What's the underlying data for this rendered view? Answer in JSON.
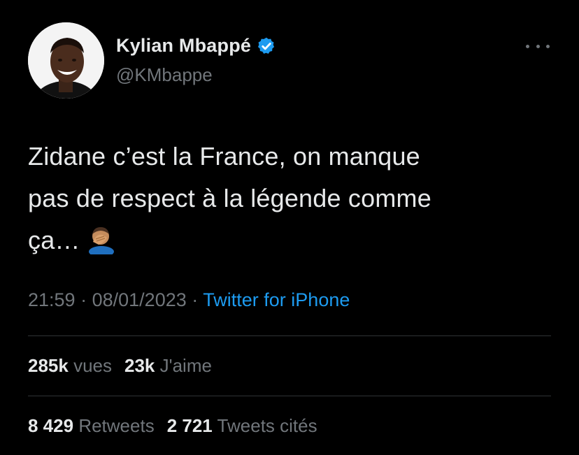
{
  "author": {
    "name": "Kylian Mbappé",
    "handle": "@KMbappe",
    "verified": true
  },
  "tweet": {
    "line1": "Zidane c’est la France, on manque",
    "line2": "pas de respect à la légende comme",
    "line3": "ça…",
    "emoji": "man-facepalming-emoji"
  },
  "meta": {
    "time": "21:59",
    "separator": "·",
    "date": "08/01/2023",
    "source": "Twitter for iPhone"
  },
  "stats": {
    "views_count": "285k",
    "views_label": "vues",
    "likes_count": "23k",
    "likes_label": "J'aime",
    "retweets_count": "8 429",
    "retweets_label": "Retweets",
    "quotes_count": "2 721",
    "quotes_label": "Tweets cités"
  },
  "colors": {
    "background": "#000000",
    "text": "#e7e9ea",
    "secondary": "#71767b",
    "link": "#1d9bf0",
    "divider": "#2f3336"
  }
}
